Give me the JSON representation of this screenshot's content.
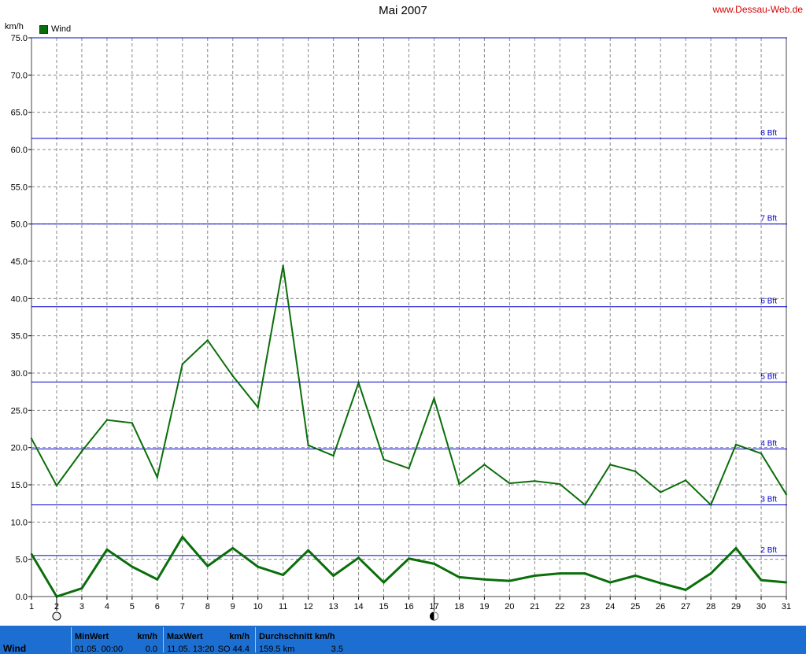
{
  "header": {
    "title": "Mai 2007",
    "site": "www.Dessau-Web.de"
  },
  "colors": {
    "series": "#0a6e0a",
    "bft_lines": "#0000cc",
    "grid": "#888888",
    "footer": "#1c6fd0"
  },
  "chart_data": {
    "type": "line",
    "unit_label": "km/h",
    "ylim": [
      0,
      75
    ],
    "y_ticks": [
      "0.0",
      "5.0",
      "10.0",
      "15.0",
      "20.0",
      "25.0",
      "30.0",
      "35.0",
      "40.0",
      "45.0",
      "50.0",
      "55.0",
      "60.0",
      "65.0",
      "70.0",
      "75.0"
    ],
    "x": [
      1,
      2,
      3,
      4,
      5,
      6,
      7,
      8,
      9,
      10,
      11,
      12,
      13,
      14,
      15,
      16,
      17,
      18,
      19,
      20,
      21,
      22,
      23,
      24,
      25,
      26,
      27,
      28,
      29,
      30,
      31
    ],
    "grid": true,
    "legend": {
      "position": "top-left",
      "entries": [
        "Wind"
      ]
    },
    "series": [
      {
        "name": "Wind",
        "kind": "max",
        "values": [
          21.2,
          14.9,
          19.5,
          23.7,
          23.3,
          16.0,
          31.2,
          34.4,
          29.6,
          25.4,
          44.4,
          20.3,
          18.9,
          28.7,
          18.4,
          17.2,
          26.6,
          15.1,
          17.7,
          15.2,
          15.5,
          15.1,
          12.3,
          17.7,
          16.8,
          14.0,
          15.6,
          12.3,
          20.4,
          19.2,
          13.7
        ]
      },
      {
        "name": "",
        "kind": "average",
        "values": [
          5.7,
          0.0,
          1.1,
          6.3,
          4.0,
          2.3,
          8.0,
          4.1,
          6.5,
          4.0,
          2.9,
          6.2,
          2.8,
          5.2,
          1.9,
          5.1,
          4.4,
          2.6,
          2.3,
          2.1,
          2.8,
          3.1,
          3.1,
          1.9,
          2.8,
          1.8,
          0.9,
          3.1,
          6.5,
          2.2,
          1.9
        ]
      }
    ],
    "beaufort_lines": [
      {
        "label": "2 Bft",
        "value": 5.5
      },
      {
        "label": "3 Bft",
        "value": 12.3
      },
      {
        "label": "4 Bft",
        "value": 19.8
      },
      {
        "label": "5 Bft",
        "value": 28.8
      },
      {
        "label": "6 Bft",
        "value": 38.9
      },
      {
        "label": "7 Bft",
        "value": 50.0
      },
      {
        "label": "8 Bft",
        "value": 61.5
      }
    ],
    "moon_phases": [
      {
        "day": 2,
        "phase": "full"
      },
      {
        "day": 17,
        "phase": "new"
      }
    ]
  },
  "footer": {
    "name": "Wind",
    "min": {
      "header": "MinWert",
      "unit": "km/h",
      "date": "01.05.  00:00",
      "value": "0.0"
    },
    "max": {
      "header": "MaxWert",
      "unit": "km/h",
      "date": "11.05.  13:20",
      "dir": "SO",
      "value": "44.4"
    },
    "avg": {
      "header": "Durchschnitt km/h",
      "distance": "159.5 km",
      "value": "3.5"
    }
  }
}
